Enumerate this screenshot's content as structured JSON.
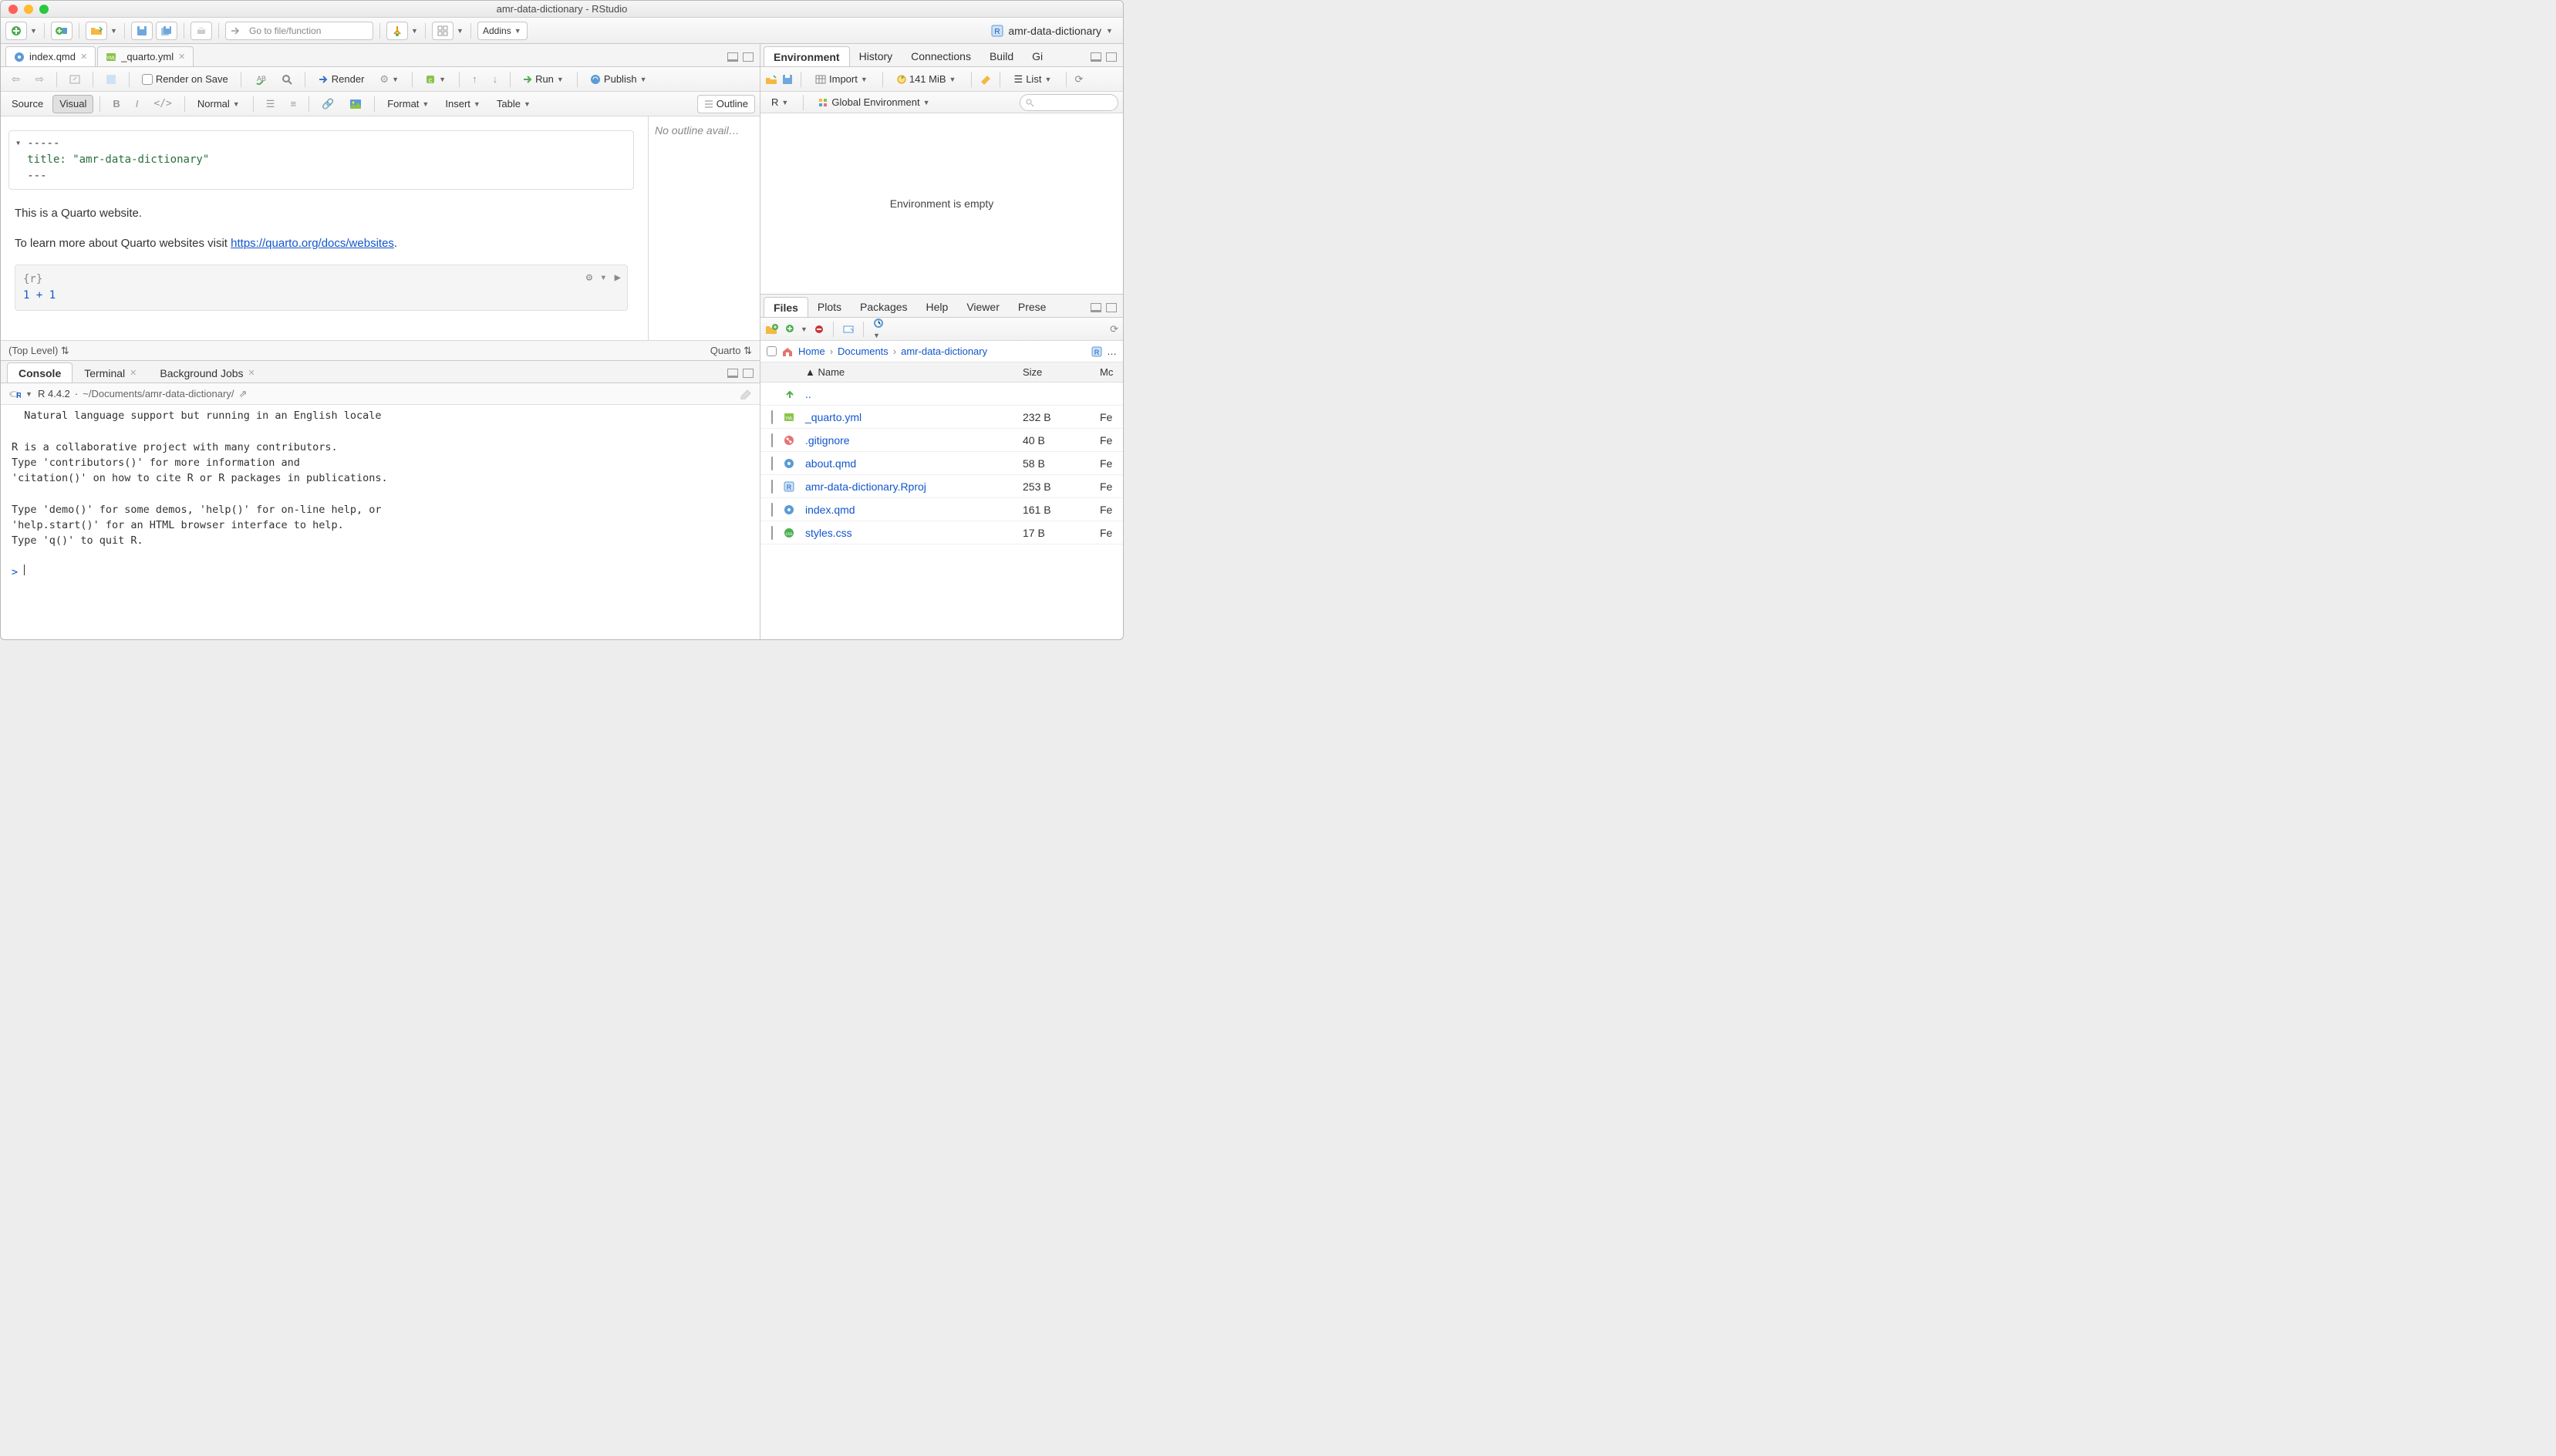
{
  "titlebar": {
    "title": "amr-data-dictionary - RStudio"
  },
  "main_toolbar": {
    "goto_placeholder": "Go to file/function",
    "addins_label": "Addins",
    "project_label": "amr-data-dictionary"
  },
  "editor": {
    "tabs": [
      {
        "label": "index.qmd"
      },
      {
        "label": "_quarto.yml"
      }
    ],
    "toolbar1": {
      "render_on_save": "Render on Save",
      "render": "Render",
      "run": "Run",
      "publish": "Publish"
    },
    "toolbar2": {
      "source": "Source",
      "visual": "Visual",
      "normal": "Normal",
      "format": "Format",
      "insert": "Insert",
      "table": "Table",
      "outline": "Outline"
    },
    "yaml": {
      "line1": "---",
      "key": "title:",
      "val": "\"amr-data-dictionary\"",
      "line3": "---"
    },
    "para1": "This is a Quarto website.",
    "para2_prefix": "To learn more about Quarto websites visit ",
    "para2_link": "https://quarto.org/docs/websites",
    "para2_suffix": ".",
    "chunk": {
      "header": "{r}",
      "code_l": "1",
      "code_op": " + ",
      "code_r": "1"
    },
    "status": {
      "toplevel": "(Top Level)",
      "lang": "Quarto"
    },
    "outline_empty": "No outline avail…"
  },
  "console": {
    "tabs": {
      "console": "Console",
      "terminal": "Terminal",
      "bgjobs": "Background Jobs"
    },
    "info": {
      "r_ver": "R 4.4.2",
      "path": "~/Documents/amr-data-dictionary/"
    },
    "text": "  Natural language support but running in an English locale\n\nR is a collaborative project with many contributors.\nType 'contributors()' for more information and\n'citation()' on how to cite R or R packages in publications.\n\nType 'demo()' for some demos, 'help()' for on-line help, or\n'help.start()' for an HTML browser interface to help.\nType 'q()' to quit R.\n",
    "prompt": "> "
  },
  "env_pane": {
    "tabs": {
      "environment": "Environment",
      "history": "History",
      "connections": "Connections",
      "build": "Build",
      "git": "Gi"
    },
    "toolbar": {
      "import": "Import",
      "mem": "141 MiB",
      "list": "List"
    },
    "scope": {
      "lang": "R",
      "global": "Global Environment"
    },
    "empty": "Environment is empty"
  },
  "files_pane": {
    "tabs": {
      "files": "Files",
      "plots": "Plots",
      "packages": "Packages",
      "help": "Help",
      "viewer": "Viewer",
      "presentation": "Prese"
    },
    "breadcrumb": {
      "home": "Home",
      "documents": "Documents",
      "project": "amr-data-dictionary",
      "more": "…"
    },
    "headers": {
      "name": "Name",
      "size": "Size",
      "mod": "Mc"
    },
    "up": "..",
    "rows": [
      {
        "name": "_quarto.yml",
        "size": "232 B",
        "mod": "Fe",
        "icon": "yml"
      },
      {
        "name": ".gitignore",
        "size": "40 B",
        "mod": "Fe",
        "icon": "git"
      },
      {
        "name": "about.qmd",
        "size": "58 B",
        "mod": "Fe",
        "icon": "qmd"
      },
      {
        "name": "amr-data-dictionary.Rproj",
        "size": "253 B",
        "mod": "Fe",
        "icon": "rproj"
      },
      {
        "name": "index.qmd",
        "size": "161 B",
        "mod": "Fe",
        "icon": "qmd"
      },
      {
        "name": "styles.css",
        "size": "17 B",
        "mod": "Fe",
        "icon": "css"
      }
    ]
  }
}
